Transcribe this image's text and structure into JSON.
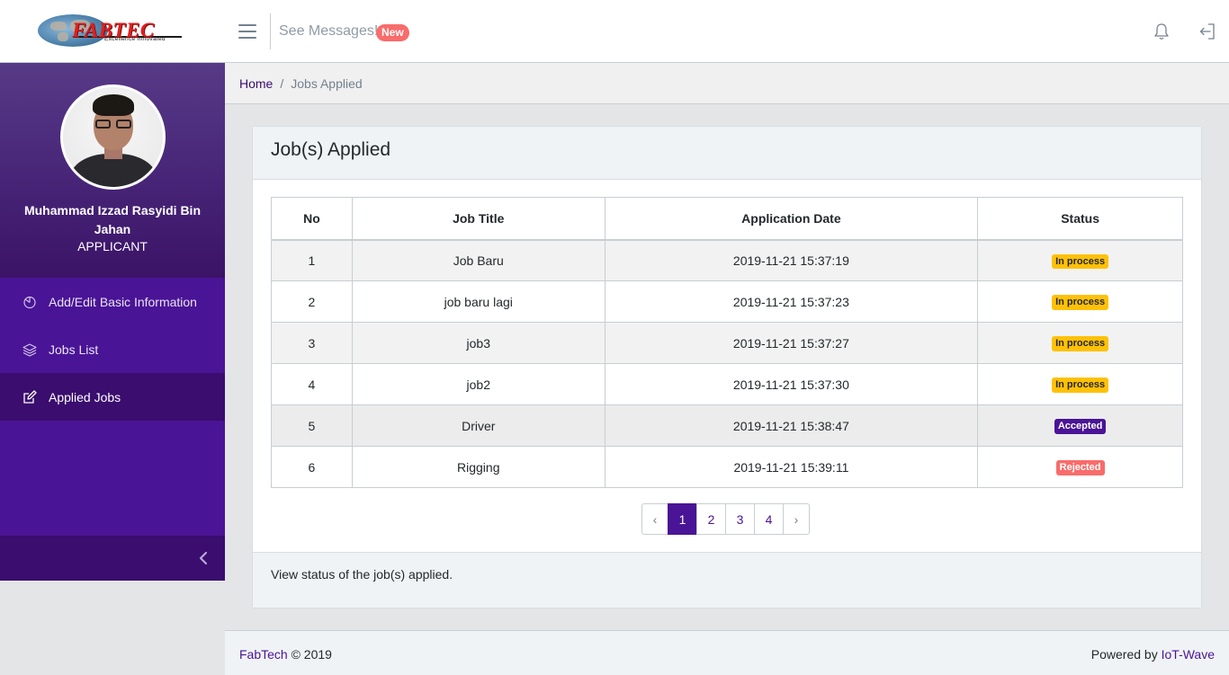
{
  "brand": {
    "logo_text": "FABTEC",
    "tagline": "Excellence Innovated"
  },
  "header": {
    "messages_label": "See Messages!",
    "messages_badge": "New",
    "bell_icon": "bell-icon",
    "logout_icon": "logout-icon"
  },
  "profile": {
    "name": "Muhammad Izzad Rasyidi Bin Jahan",
    "role": "APPLICANT"
  },
  "nav": [
    {
      "label": "Add/Edit Basic Information",
      "icon": "pie-chart-icon",
      "active": false
    },
    {
      "label": "Jobs List",
      "icon": "layers-icon",
      "active": false
    },
    {
      "label": "Applied Jobs",
      "icon": "edit-icon",
      "active": true
    }
  ],
  "breadcrumb": {
    "home": "Home",
    "separator": "/",
    "current": "Jobs Applied"
  },
  "card": {
    "title": "Job(s) Applied",
    "footer_text": "View status of the job(s) applied."
  },
  "table": {
    "headers": [
      "No",
      "Job Title",
      "Application Date",
      "Status"
    ],
    "rows": [
      {
        "no": "1",
        "title": "Job Baru",
        "date": "2019-11-21 15:37:19",
        "status": "In process",
        "status_type": "process"
      },
      {
        "no": "2",
        "title": "job baru lagi",
        "date": "2019-11-21 15:37:23",
        "status": "In process",
        "status_type": "process"
      },
      {
        "no": "3",
        "title": "job3",
        "date": "2019-11-21 15:37:27",
        "status": "In process",
        "status_type": "process"
      },
      {
        "no": "4",
        "title": "job2",
        "date": "2019-11-21 15:37:30",
        "status": "In process",
        "status_type": "process"
      },
      {
        "no": "5",
        "title": "Driver",
        "date": "2019-11-21 15:38:47",
        "status": "Accepted",
        "status_type": "accepted"
      },
      {
        "no": "6",
        "title": "Rigging",
        "date": "2019-11-21 15:39:11",
        "status": "Rejected",
        "status_type": "rejected"
      }
    ]
  },
  "pagination": {
    "prev": "‹",
    "pages": [
      "1",
      "2",
      "3",
      "4"
    ],
    "current": "1",
    "next": "›"
  },
  "footer": {
    "brand_link": "FabTech",
    "copyright": "© 2019",
    "powered_label": "Powered by",
    "powered_link": "IoT-Wave"
  },
  "colors": {
    "primary": "#4a1496",
    "sidebar_active": "#3a0d6e",
    "warning": "#ffc107",
    "danger": "#f86c6b"
  }
}
